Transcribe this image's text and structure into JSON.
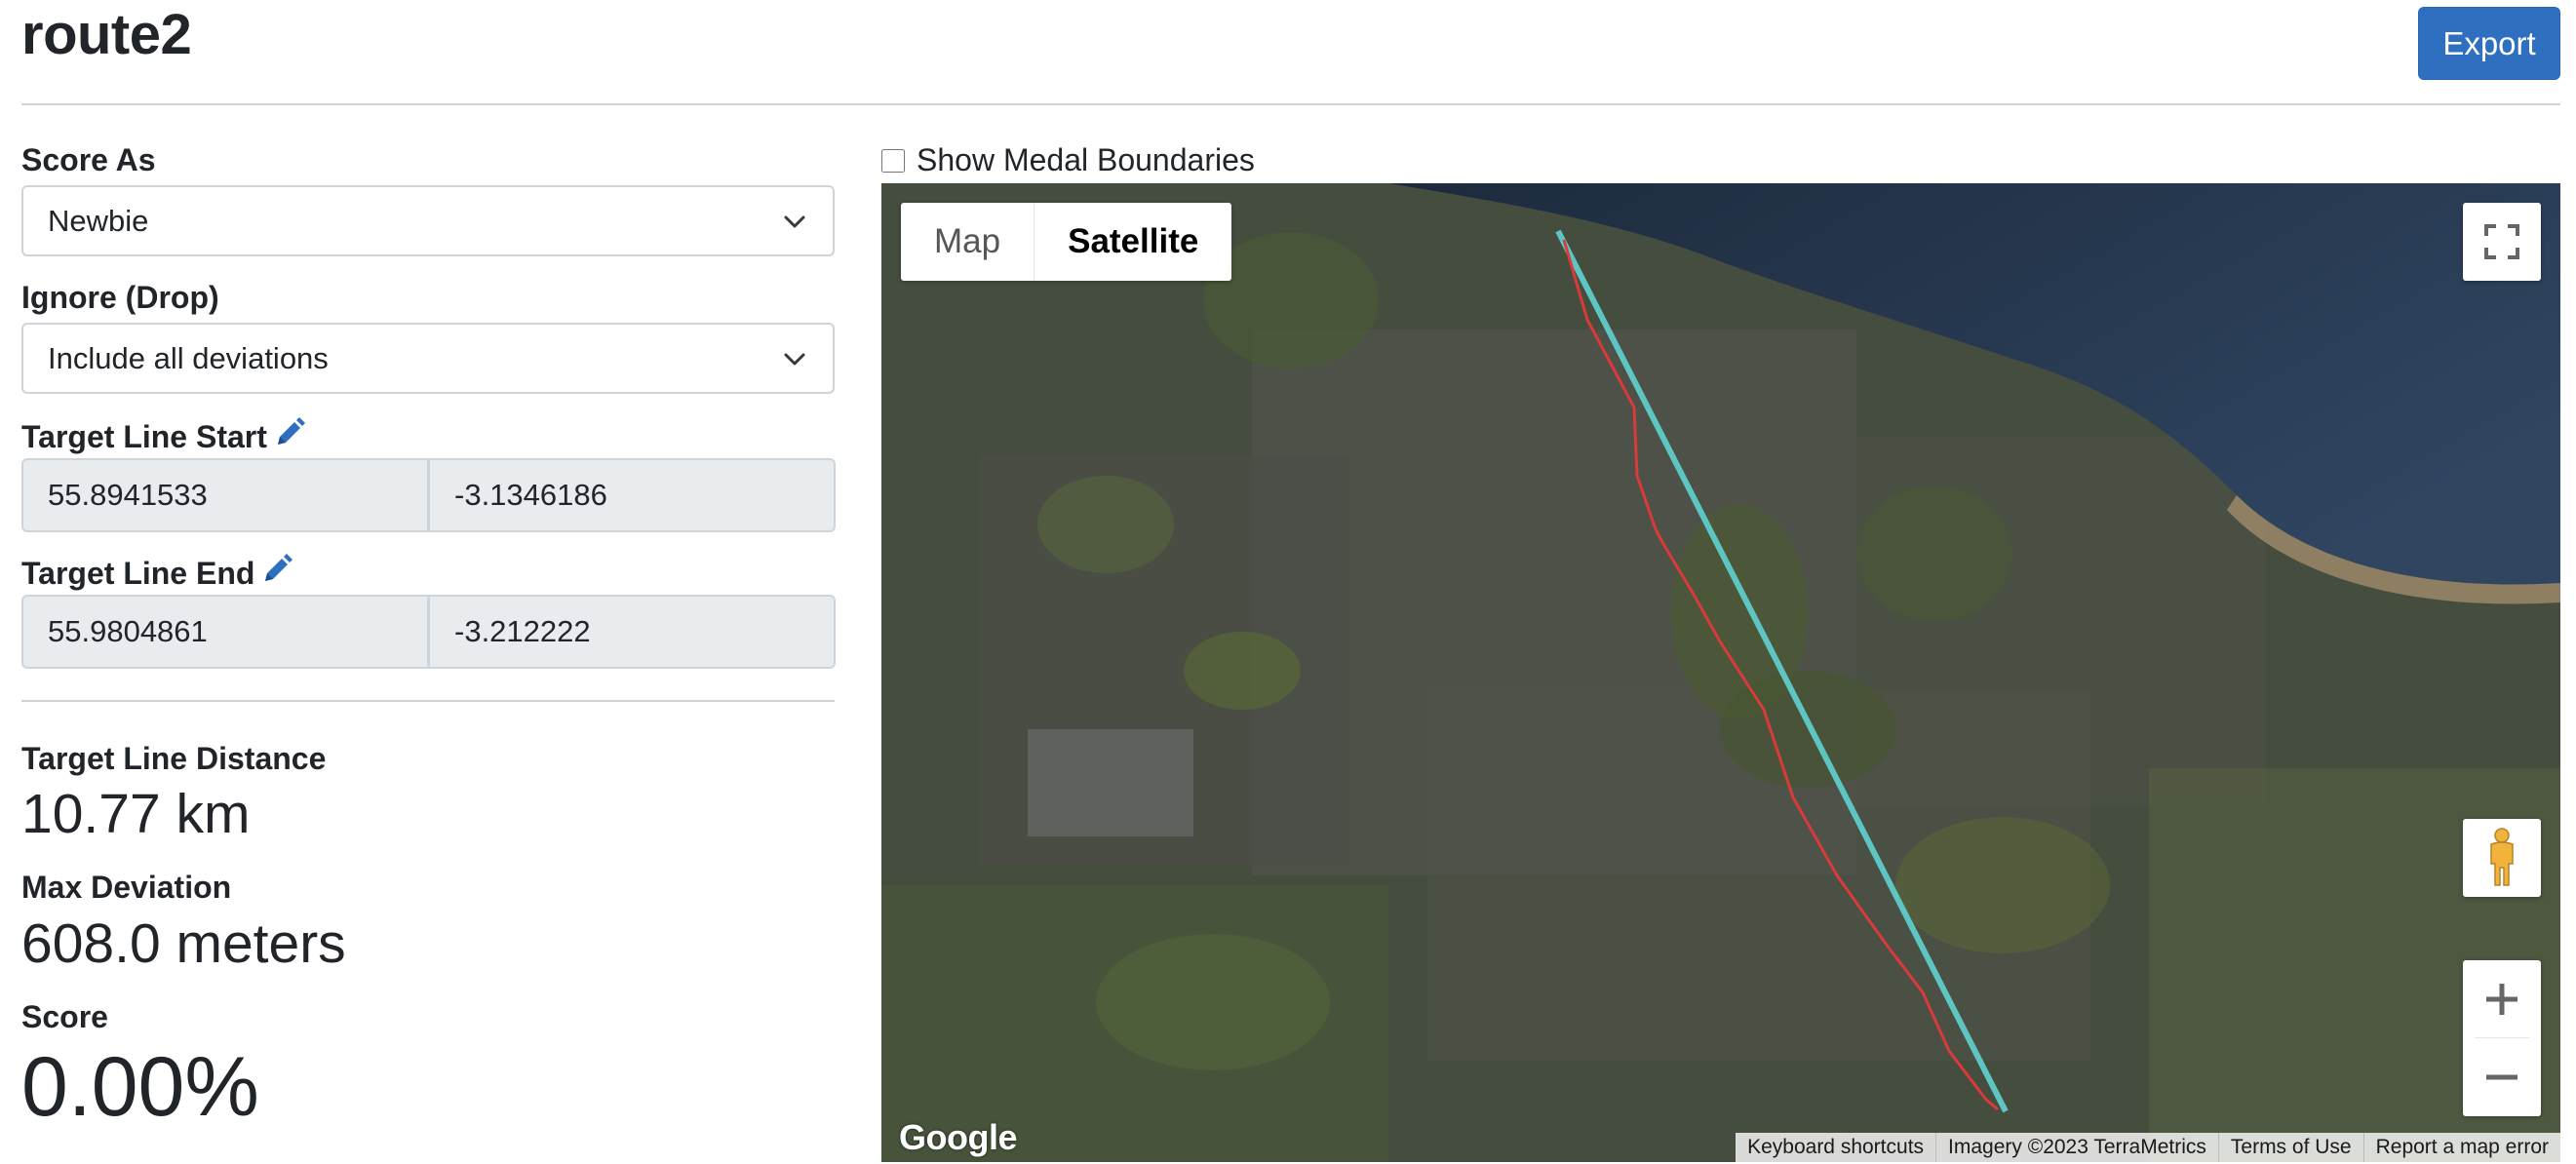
{
  "page": {
    "title": "route2",
    "export_label": "Export"
  },
  "form": {
    "score_as": {
      "label": "Score As",
      "value": "Newbie"
    },
    "ignore": {
      "label": "Ignore (Drop)",
      "value": "Include all deviations"
    },
    "target_start": {
      "label": "Target Line Start",
      "lat": "55.8941533",
      "lng": "-3.1346186"
    },
    "target_end": {
      "label": "Target Line End",
      "lat": "55.9804861",
      "lng": "-3.212222"
    }
  },
  "stats": {
    "distance_label": "Target Line Distance",
    "distance_value": "10.77 km",
    "deviation_label": "Max Deviation",
    "deviation_value": "608.0 meters",
    "score_label": "Score",
    "score_value": "0.00%"
  },
  "map": {
    "medal_label": "Show Medal Boundaries",
    "medal_checked": false,
    "type_map": "Map",
    "type_satellite": "Satellite",
    "active_type": "Satellite",
    "logo": "Google",
    "attribution": [
      "Keyboard shortcuts",
      "Imagery ©2023 TerraMetrics",
      "Terms of Use",
      "Report a map error"
    ],
    "target_line_color": "#5ec6c2",
    "route_color": "#d93a3a",
    "icons": [
      "fullscreen-icon",
      "pegman-icon",
      "zoom-in-icon",
      "zoom-out-icon",
      "chevron-down-icon",
      "pencil-icon"
    ]
  },
  "colors": {
    "primary": "#2f6fc0",
    "input_disabled_bg": "#e9ecef",
    "border": "#ced4da"
  }
}
